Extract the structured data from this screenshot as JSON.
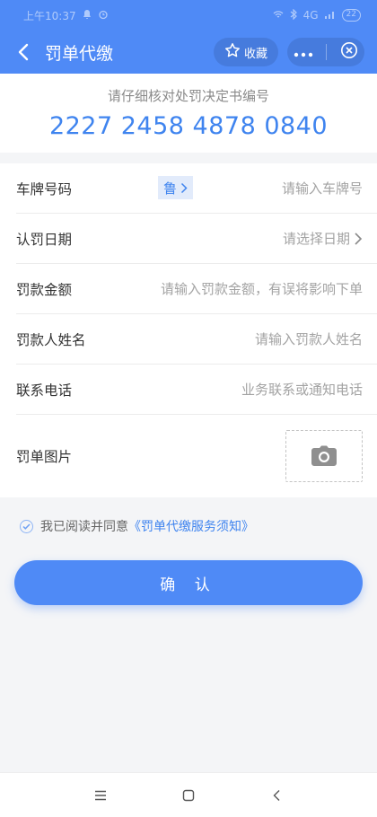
{
  "status": {
    "time": "上午10:37",
    "network": "4G",
    "battery": "22"
  },
  "header": {
    "title": "罚单代缴",
    "favorite_label": "收藏"
  },
  "ticket": {
    "hint": "请仔细核对处罚决定书编号",
    "number": "2227 2458 4878 0840"
  },
  "form": {
    "plate": {
      "label": "车牌号码",
      "province": "鲁",
      "placeholder": "请输入车牌号"
    },
    "date": {
      "label": "认罚日期",
      "placeholder": "请选择日期"
    },
    "amount": {
      "label": "罚款金额",
      "placeholder": "请输入罚款金额，有误将影响下单"
    },
    "name": {
      "label": "罚款人姓名",
      "placeholder": "请输入罚款人姓名"
    },
    "phone": {
      "label": "联系电话",
      "placeholder": "业务联系或通知电话"
    },
    "photo": {
      "label": "罚单图片"
    }
  },
  "agreement": {
    "prefix": "我已阅读并同意",
    "link": "《罚单代缴服务须知》"
  },
  "confirm_label": "确 认",
  "colors": {
    "brand": "#4f8af6",
    "link": "#3f84ef"
  }
}
